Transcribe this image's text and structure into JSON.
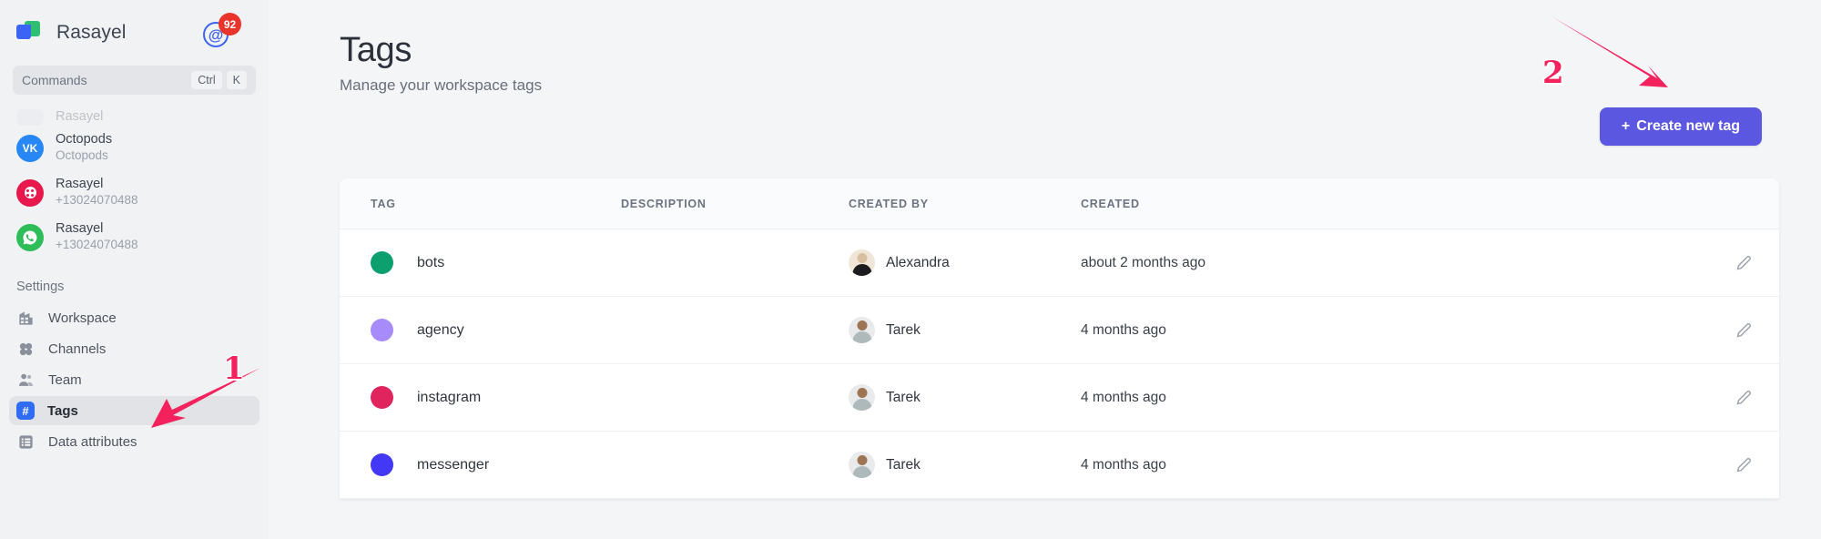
{
  "sidebar": {
    "brand": {
      "name": "Rasayel",
      "logo_icon": "rasayel-logo-icon"
    },
    "mentions": {
      "icon": "at-mention-icon",
      "badge_count": "92"
    },
    "commands": {
      "label": "Commands",
      "key_modifier": "Ctrl",
      "key_letter": "K"
    },
    "channels": [
      {
        "icon": "vk-icon",
        "title": "Octopods",
        "subtitle": "Octopods"
      },
      {
        "icon": "rasayel-channel-icon",
        "title": "Rasayel",
        "subtitle": "+13024070488"
      },
      {
        "icon": "whatsapp-icon",
        "title": "Rasayel",
        "subtitle": "+13024070488"
      }
    ],
    "settings_label": "Settings",
    "nav": [
      {
        "label": "Workspace",
        "icon": "building-icon",
        "active": false
      },
      {
        "label": "Channels",
        "icon": "channels-icon",
        "active": false
      },
      {
        "label": "Team",
        "icon": "team-icon",
        "active": false
      },
      {
        "label": "Tags",
        "icon": "hash-icon",
        "active": true
      },
      {
        "label": "Data attributes",
        "icon": "list-icon",
        "active": false
      }
    ]
  },
  "main": {
    "title": "Tags",
    "subtitle": "Manage your workspace tags",
    "create_button": {
      "label": "Create new tag",
      "prefix": "+",
      "color": "#5b57e0"
    }
  },
  "table": {
    "headers": [
      "TAG",
      "DESCRIPTION",
      "CREATED BY",
      "CREATED"
    ],
    "rows": [
      {
        "tag": "bots",
        "color": "#0e9f6e",
        "description": "",
        "created_by": "Alexandra",
        "avatar": "av-alexandra",
        "created": "about 2 months ago",
        "edit_icon": "pencil-icon"
      },
      {
        "tag": "agency",
        "color": "#a78bfa",
        "description": "",
        "created_by": "Tarek",
        "avatar": "av-tarek",
        "created": "4 months ago",
        "edit_icon": "pencil-icon"
      },
      {
        "tag": "instagram",
        "color": "#e0245e",
        "description": "",
        "created_by": "Tarek",
        "avatar": "av-tarek",
        "created": "4 months ago",
        "edit_icon": "pencil-icon"
      },
      {
        "tag": "messenger",
        "color": "#4338f5",
        "description": "",
        "created_by": "Tarek",
        "avatar": "av-tarek",
        "created": "4 months ago",
        "edit_icon": "pencil-icon"
      }
    ]
  },
  "annotations": {
    "color": "#f4225c",
    "marks": [
      {
        "number": "1",
        "points_to": "sidebar-item-tags"
      },
      {
        "number": "2",
        "points_to": "create-new-tag-button"
      }
    ]
  }
}
